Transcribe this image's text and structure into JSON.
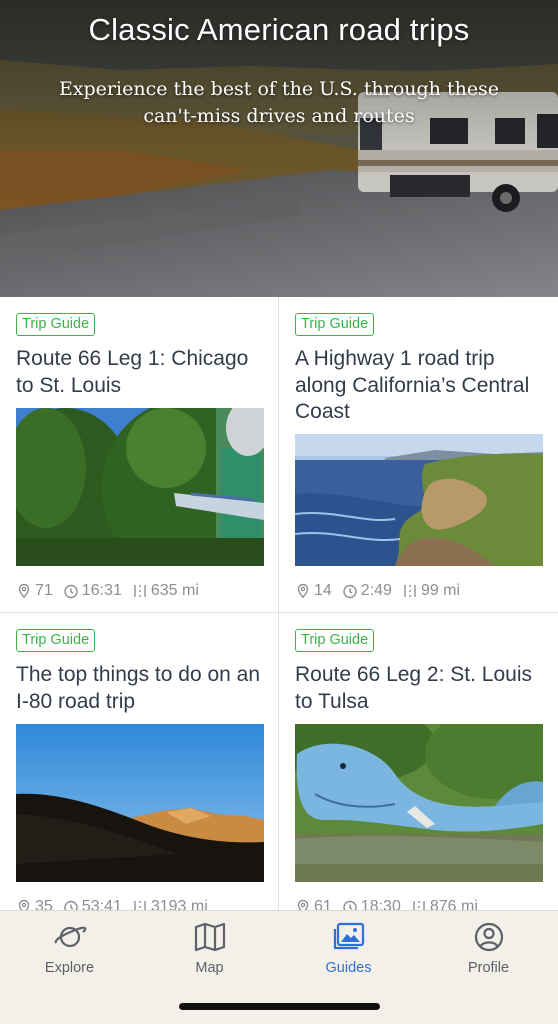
{
  "hero": {
    "title": "Classic American road trips",
    "subtitle": "Experience the best of the U.S. through these can't-miss drives and routes"
  },
  "cards": [
    {
      "badge": "Trip Guide",
      "title": "Route 66 Leg 1: Chicago to St. Louis",
      "stops": "71",
      "duration": "16:31",
      "distance": "635 mi",
      "image": "route66-gemini-giant"
    },
    {
      "badge": "Trip Guide",
      "title": "A Highway 1 road trip along California’s Central Coast",
      "stops": "14",
      "duration": "2:49",
      "distance": "99 mi",
      "image": "california-coast-cliffs"
    },
    {
      "badge": "Trip Guide",
      "title": "The top things to do on an I-80 road trip",
      "stops": "35",
      "duration": "53:41",
      "distance": "3193 mi",
      "image": "mountain-sunset-silhouette"
    },
    {
      "badge": "Trip Guide",
      "title": "Route 66 Leg 2: St. Louis to Tulsa",
      "stops": "61",
      "duration": "18:30",
      "distance": "876 mi",
      "image": "blue-whale-catoosa"
    }
  ],
  "tabbar": {
    "tabs": [
      {
        "label": "Explore",
        "icon": "planet-icon",
        "active": false
      },
      {
        "label": "Map",
        "icon": "map-icon",
        "active": false
      },
      {
        "label": "Guides",
        "icon": "guides-icon",
        "active": true
      },
      {
        "label": "Profile",
        "icon": "profile-icon",
        "active": false
      }
    ]
  },
  "colors": {
    "badge_green": "#3bb34a",
    "title_text": "#333c4a",
    "meta_text": "#8b8e93",
    "tab_active": "#2f6fd6",
    "tabbar_bg": "#f3f0ea"
  },
  "icons": {
    "stops": "map-pin-icon",
    "duration": "clock-icon",
    "distance": "road-icon"
  }
}
